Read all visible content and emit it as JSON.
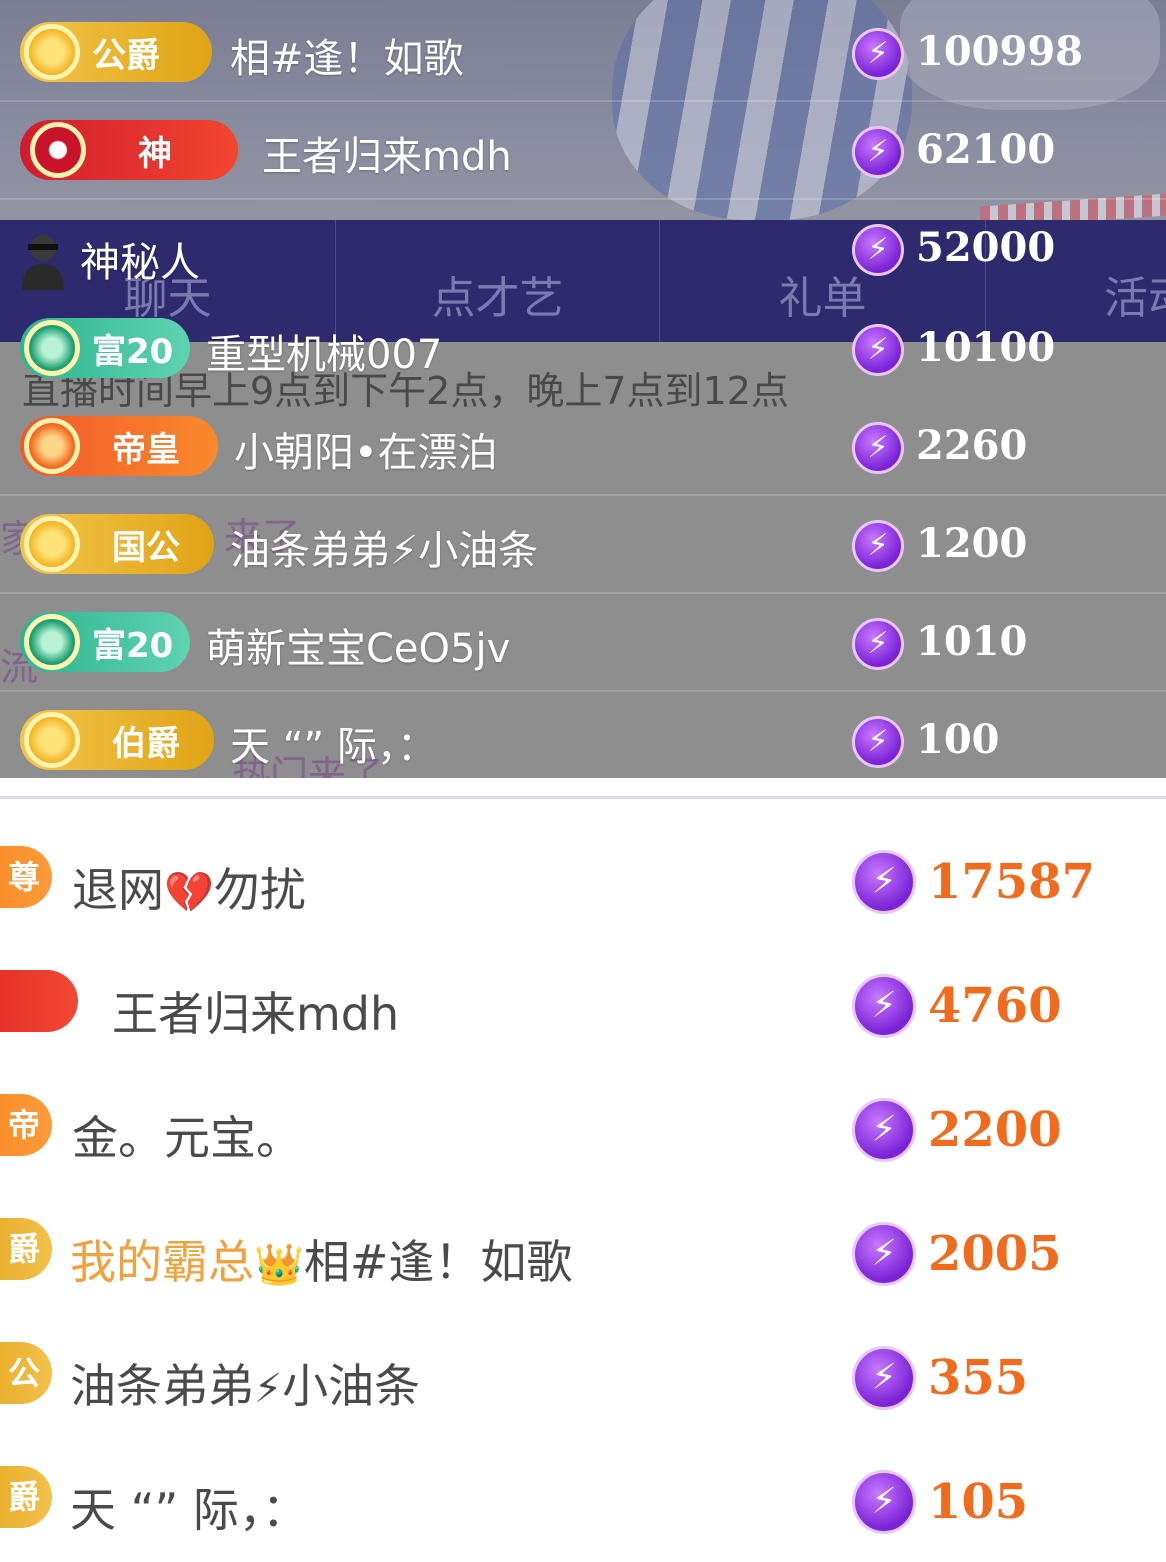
{
  "colors": {
    "tab_bar": "#2e2a6e",
    "score_orange": "#f26b1d",
    "gift_purple": "#7a22d6",
    "name_highlight": "#f2a23c"
  },
  "tabs": [
    "聊天",
    "点才艺",
    "礼单",
    "活动"
  ],
  "notice": "直播时间早上9点到下午2点，晚上7点到12点",
  "ghost_text": [
    "家",
    "来了",
    "流",
    "热门来了"
  ],
  "top_ranking": [
    {
      "badge": "公爵",
      "badge_style": "gold",
      "name": "相#逢！如歌",
      "score": "100998"
    },
    {
      "badge": "神",
      "badge_style": "red",
      "name": "王者归来mdh",
      "score": "62100"
    },
    {
      "badge": "",
      "badge_style": "mystery",
      "name": "神秘人",
      "score": "52000"
    },
    {
      "badge": "富20",
      "badge_style": "green",
      "name": "重型机械007",
      "score": "10100"
    },
    {
      "badge": "帝皇",
      "badge_style": "orange",
      "name": "小朝阳•在漂泊",
      "score": "2260"
    },
    {
      "badge": "国公",
      "badge_style": "gold",
      "name": "油条弟弟⚡小油条",
      "score": "1200"
    },
    {
      "badge": "富20",
      "badge_style": "green",
      "name": "萌新宝宝CeO5jv",
      "score": "1010"
    },
    {
      "badge": "伯爵",
      "badge_style": "gold",
      "name": "天 “” 际，：",
      "score": "100"
    }
  ],
  "bottom_ranking": [
    {
      "badge": "尊",
      "badge_color": "#f7851f",
      "name_parts": [
        "退网",
        "💔",
        "勿扰"
      ],
      "score": "17587"
    },
    {
      "badge": "",
      "badge_color": "#e8322a",
      "name_parts": [
        "王者归来mdh"
      ],
      "score": "4760"
    },
    {
      "badge": "帝",
      "badge_color": "#f7851f",
      "name_parts": [
        "金。元宝。"
      ],
      "score": "2200"
    },
    {
      "badge": "爵",
      "badge_color": "#e9ae2a",
      "name_parts": [
        "我的霸总",
        "👑",
        "相#逢！如歌"
      ],
      "score": "2005"
    },
    {
      "badge": "公",
      "badge_color": "#e9ae2a",
      "name_parts": [
        "油条弟弟",
        "⚡",
        "小油条"
      ],
      "score": "355"
    },
    {
      "badge": "爵",
      "badge_color": "#e9ae2a",
      "name_parts": [
        "天 “” 际，："
      ],
      "score": "105"
    }
  ],
  "icons": {
    "gift": "lightning-coin-icon",
    "mystery": "masked-user-icon"
  }
}
